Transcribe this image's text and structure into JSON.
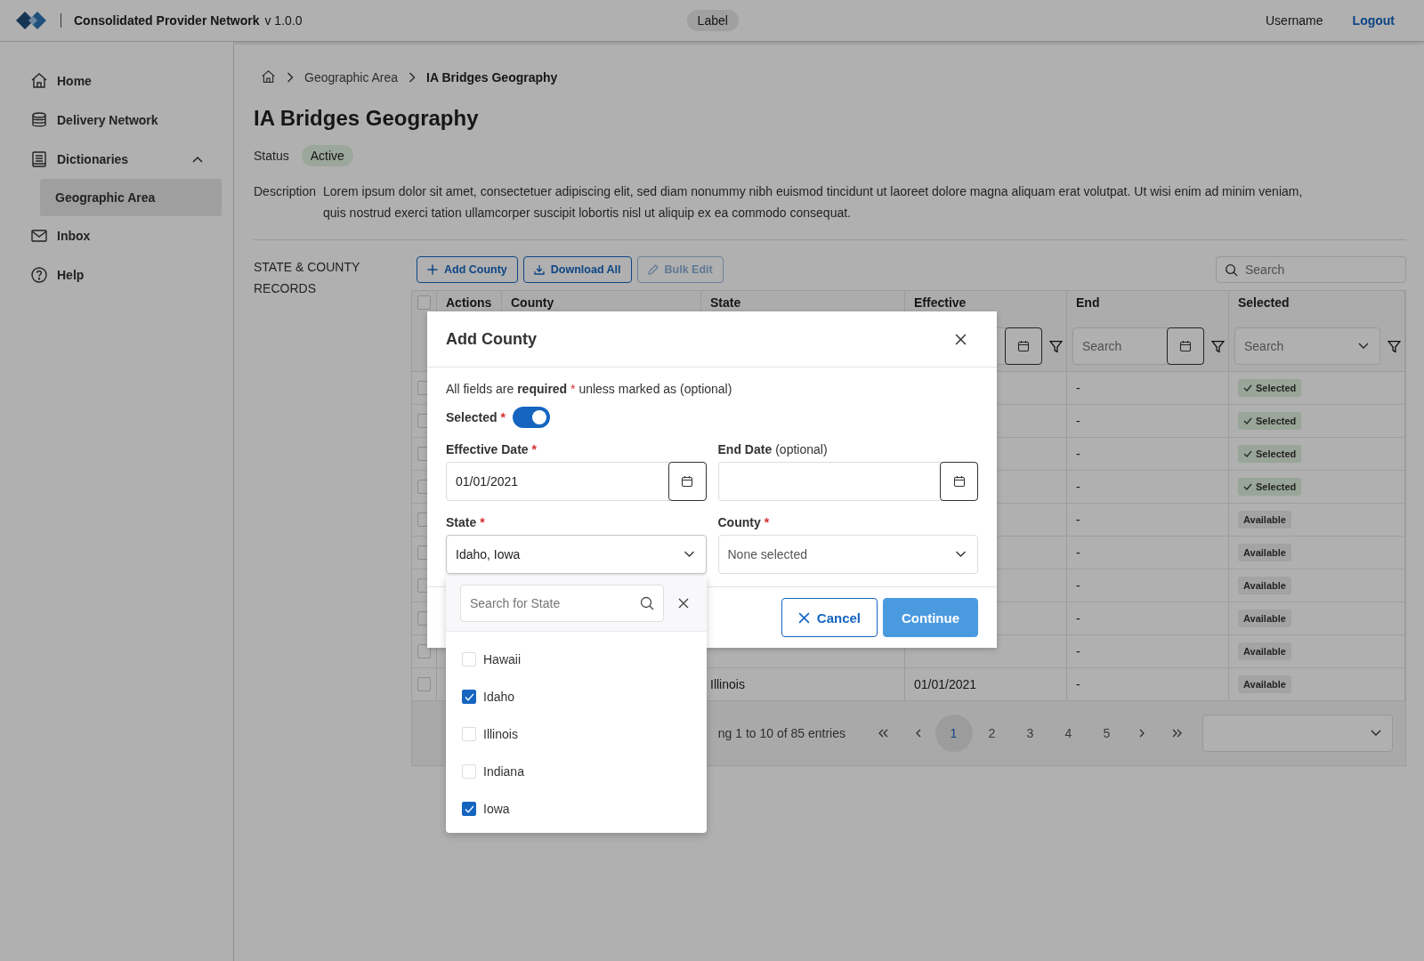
{
  "header": {
    "app_name": "Consolidated Provider Network",
    "version": "v 1.0.0",
    "label": "Label",
    "username": "Username",
    "logout": "Logout"
  },
  "sidebar": {
    "items": [
      {
        "label": "Home",
        "kind": "home",
        "selected": false
      },
      {
        "label": "Delivery Network",
        "kind": "database",
        "selected": false
      },
      {
        "label": "Dictionaries",
        "kind": "book",
        "selected": false,
        "expanded": true,
        "children": [
          {
            "label": "Geographic Area",
            "selected": true
          }
        ]
      },
      {
        "label": "Inbox",
        "kind": "mail",
        "selected": false
      },
      {
        "label": "Help",
        "kind": "help",
        "selected": false
      }
    ]
  },
  "breadcrumb": [
    "Geographic Area",
    "IA Bridges Geography"
  ],
  "page": {
    "title": "IA Bridges Geography",
    "status_label": "Status",
    "status": "Active",
    "description_label": "Description",
    "description": "Lorem ipsum dolor sit amet, consectetuer adipiscing elit, sed diam nonummy nibh euismod tincidunt ut laoreet dolore magna aliquam erat volutpat. Ut wisi enim ad minim veniam, quis nostrud exerci tation ullamcorper suscipit lobortis nisl ut aliquip ex ea commodo consequat."
  },
  "records": {
    "section_title": "STATE & COUNTY RECORDS",
    "toolbar": [
      {
        "label": "Add County",
        "kind": "add",
        "disabled": false
      },
      {
        "label": "Download All",
        "kind": "download",
        "disabled": false
      },
      {
        "label": "Bulk Edit",
        "kind": "edit",
        "disabled": true
      }
    ],
    "search": {
      "placeholder": "Search"
    },
    "table": {
      "select_all_checked": false,
      "columns": [
        "Actions",
        "County",
        "State",
        "Effective",
        "End",
        "Selected"
      ],
      "filters": [
        {
          "kind": "date"
        },
        {
          "kind": "date",
          "placeholder": "Search"
        },
        {
          "kind": "select",
          "placeholder": "Search"
        }
      ],
      "rows": [
        {
          "checked": false,
          "end": "-",
          "badge": {
            "kind": "selected",
            "label": "Selected"
          }
        },
        {
          "checked": false,
          "end": "-",
          "badge": {
            "kind": "selected",
            "label": "Selected"
          }
        },
        {
          "checked": false,
          "end": "-",
          "badge": {
            "kind": "selected",
            "label": "Selected"
          }
        },
        {
          "checked": false,
          "end": "-",
          "badge": {
            "kind": "selected",
            "label": "Selected"
          }
        },
        {
          "checked": false,
          "end": "-",
          "badge": {
            "kind": "available",
            "label": "Available"
          }
        },
        {
          "checked": false,
          "end": "-",
          "badge": {
            "kind": "available",
            "label": "Available"
          }
        },
        {
          "checked": false,
          "end": "-",
          "badge": {
            "kind": "available",
            "label": "Available"
          }
        },
        {
          "checked": false,
          "end": "-",
          "badge": {
            "kind": "available",
            "label": "Available"
          }
        },
        {
          "checked": false,
          "end": "-",
          "badge": {
            "kind": "available",
            "label": "Available"
          }
        },
        {
          "checked": false,
          "state": "Illinois",
          "effective": "01/01/2021",
          "end": "-",
          "badge": {
            "kind": "available",
            "label": "Available"
          }
        }
      ]
    },
    "pagination": {
      "info": "ng 1 to 10 of 85 entries",
      "pages": [
        {
          "label": "1",
          "selected": true
        },
        {
          "label": "2",
          "selected": false
        },
        {
          "label": "3",
          "selected": false
        },
        {
          "label": "4",
          "selected": false
        },
        {
          "label": "5",
          "selected": false
        }
      ]
    }
  },
  "modal": {
    "title": "Add County",
    "note": "All fields are **required**",
    "note_mark": "*",
    "note_after": "unless marked as (optional)",
    "toggle": {
      "label": "Selected",
      "required": true,
      "on": true
    },
    "fields": [
      {
        "label": "Effective Date",
        "required": true,
        "kind": "date",
        "value": "01/01/2021"
      },
      {
        "label": "End Date",
        "required": false,
        "optional": "(optional)",
        "kind": "date"
      },
      {
        "label": "State",
        "required": true,
        "kind": "select",
        "value": "Idaho, Iowa",
        "expanded": true
      },
      {
        "label": "County",
        "required": true,
        "kind": "select",
        "placeholder": "None selected",
        "expanded": false
      }
    ],
    "dropdown": {
      "search_placeholder": "Search for State",
      "options": [
        {
          "label": "Hawaii",
          "checked": false
        },
        {
          "label": "Idaho",
          "checked": true
        },
        {
          "label": "Illinois",
          "checked": false
        },
        {
          "label": "Indiana",
          "checked": false
        },
        {
          "label": "Iowa",
          "checked": true
        }
      ]
    },
    "buttons": [
      {
        "label": "Cancel",
        "kind": "cancel"
      },
      {
        "label": "Continue",
        "kind": "primary"
      }
    ]
  }
}
